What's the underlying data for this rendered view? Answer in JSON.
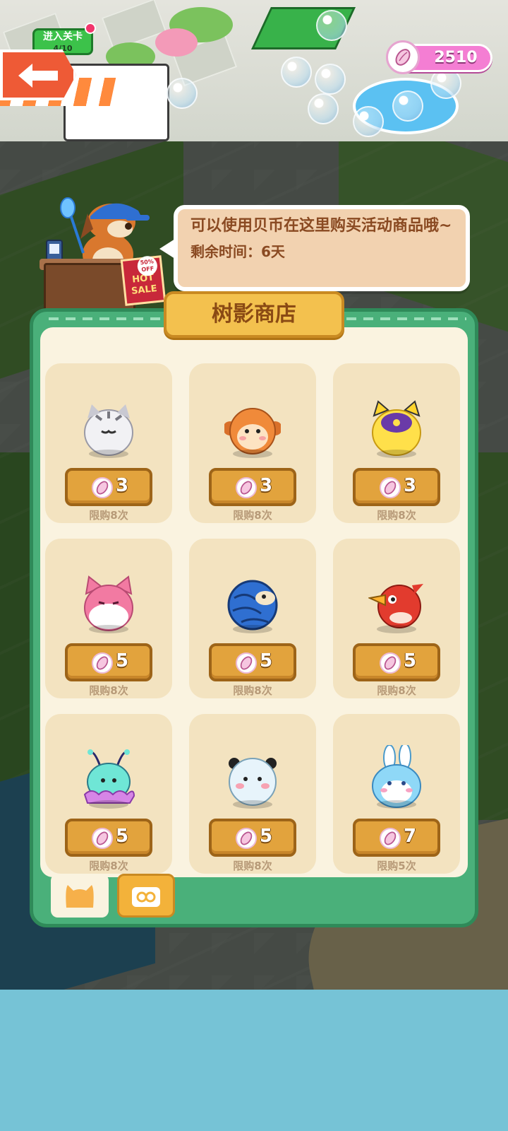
{
  "hud": {
    "level_label": "进入关卡",
    "level_progress": "4/10",
    "currency_amount": "2510"
  },
  "speech": {
    "message": "可以使用贝币在这里购买活动商品哦~",
    "remaining": "剩余时间：6天"
  },
  "sign": {
    "discount": "50% OFF",
    "hot": "HOT",
    "sale": "SALE"
  },
  "shop": {
    "title": "树影商店",
    "items": [
      {
        "name": "gray-tabby-cat",
        "price": "3",
        "limit": "限购8次",
        "color": "#e9e9ee"
      },
      {
        "name": "orange-monkey",
        "price": "3",
        "limit": "限购8次",
        "color": "#f08a3a"
      },
      {
        "name": "yellow-purple-cat",
        "price": "3",
        "limit": "限购8次",
        "color": "#ffe04a"
      },
      {
        "name": "pink-fox",
        "price": "5",
        "limit": "限购8次",
        "color": "#f27aa2"
      },
      {
        "name": "blue-pangolin",
        "price": "5",
        "limit": "限购8次",
        "color": "#2f6fd1"
      },
      {
        "name": "red-bird",
        "price": "5",
        "limit": "限购8次",
        "color": "#e23b2e"
      },
      {
        "name": "teal-jellyfish",
        "price": "5",
        "limit": "限购8次",
        "color": "#6fe6d6"
      },
      {
        "name": "white-panda",
        "price": "5",
        "limit": "限购8次",
        "color": "#e7f4fb"
      },
      {
        "name": "blue-bunny",
        "price": "7",
        "limit": "限购5次",
        "color": "#8fd8f7"
      }
    ]
  },
  "tabs": [
    {
      "name": "cat-tab",
      "icon": "cat-icon",
      "active": true
    },
    {
      "name": "gift-tab",
      "icon": "gift-icon",
      "active": false
    }
  ],
  "colors": {
    "panel_green": "#4ab07a",
    "title_gold": "#f3c14e",
    "price_gold": "#e2a33d",
    "currency_pink": "#f47ed3"
  }
}
